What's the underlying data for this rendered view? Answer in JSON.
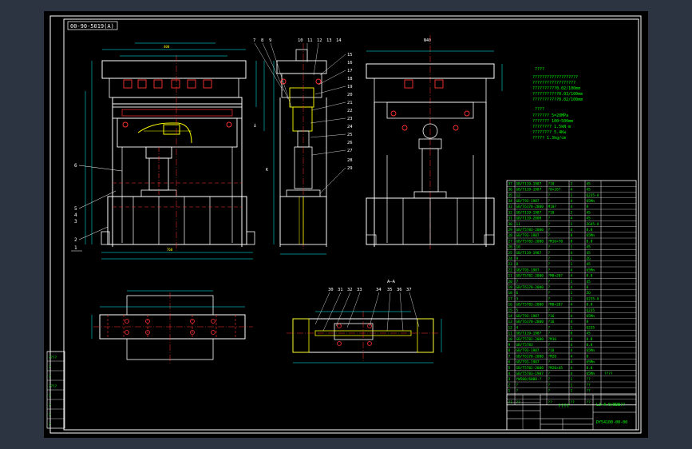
{
  "title_tag": "00-90-5019(A)",
  "section_label": "A—A",
  "section_arrow_label": "A",
  "view_label": "K",
  "top_dim_label": "N40",
  "notes_heading_1": "????",
  "notes_lines_1": [
    "???????????????????",
    "??????????????????",
    "??????????0.02/100mm",
    "???????????0.03/100mm",
    "???????????0.02/100mm"
  ],
  "notes_heading_2": "????",
  "notes_lines_2": [
    "??????? 5=20MPa",
    "??????? 100~500mm",
    "???????? 1.5kN·m",
    "???????? 5.4Kw",
    "????? 1.3kg/cm"
  ],
  "side_callouts": [
    "7",
    "8",
    "9",
    "10",
    "11",
    "12",
    "13",
    "14",
    "15",
    "16",
    "17",
    "18",
    "19",
    "20",
    "21",
    "22",
    "23",
    "24",
    "25",
    "26",
    "27",
    "28",
    "29"
  ],
  "left_callouts": [
    "6",
    "5",
    "4",
    "3",
    "2",
    "1"
  ],
  "section_callouts": [
    "30",
    "31",
    "32",
    "33",
    "34",
    "35",
    "36",
    "37"
  ],
  "bom_rows": [
    {
      "no": "37",
      "code": "GB/T119-1987",
      "name": "?10",
      "qty": "2",
      "mat": "45"
    },
    {
      "no": "36",
      "code": "GB/T119-1987",
      "name": "?8×26?",
      "qty": "4",
      "mat": "45"
    },
    {
      "no": "35",
      "code": "12",
      "name": "?",
      "qty": "1",
      "mat": "Q235-A"
    },
    {
      "no": "34",
      "code": "GB/T93-1987",
      "name": "?",
      "qty": "4",
      "mat": "65Mn"
    },
    {
      "no": "33",
      "code": "GB/T6170-2000",
      "name": "M10?",
      "qty": "4",
      "mat": "8"
    },
    {
      "no": "32",
      "code": "GB/T119-1987",
      "name": "?10",
      "qty": "2",
      "mat": "45"
    },
    {
      "no": "31",
      "code": "GB/T119-2000",
      "name": "?",
      "qty": "4",
      "mat": "45"
    },
    {
      "no": "30",
      "code": "11",
      "name": "?",
      "qty": "1",
      "mat": "ZG45-A"
    },
    {
      "no": "29",
      "code": "GB/T5783-2000",
      "name": "?",
      "qty": "4",
      "mat": "8.8"
    },
    {
      "no": "28",
      "code": "GB/T93-1987",
      "name": "?",
      "qty": "8",
      "mat": "65Mn"
    },
    {
      "no": "27",
      "code": "GB/T5783-2000",
      "name": "?M16×70",
      "qty": "8",
      "mat": "8.8"
    },
    {
      "no": "26",
      "code": "10",
      "name": "?",
      "qty": "1",
      "mat": "45"
    },
    {
      "no": "25",
      "code": "GB/T119-1987",
      "name": "?",
      "qty": "4",
      "mat": "45"
    },
    {
      "no": "24",
      "code": "9",
      "name": "?",
      "qty": "1",
      "mat": "ZG"
    },
    {
      "no": "23",
      "code": "8",
      "name": "?",
      "qty": "1",
      "mat": "45"
    },
    {
      "no": "22",
      "code": "GB/T93-1987",
      "name": "?",
      "qty": "4",
      "mat": "65Mn"
    },
    {
      "no": "21",
      "code": "GB/T5782-2000",
      "name": "?M8×20?",
      "qty": "4",
      "mat": "8.8"
    },
    {
      "no": "20",
      "code": "7",
      "name": "?",
      "qty": "1",
      "mat": "45"
    },
    {
      "no": "19",
      "code": "GB/T6170-2000",
      "name": "?",
      "qty": "4",
      "mat": "8"
    },
    {
      "no": "18",
      "code": "6",
      "name": "?",
      "qty": "1",
      "mat": "ZQ"
    },
    {
      "no": "17",
      "code": "3",
      "name": "?",
      "qty": "1",
      "mat": "Q235-A"
    },
    {
      "no": "16",
      "code": "GB/T5783-2000",
      "name": "?M8×20?",
      "qty": "4",
      "mat": "8.8"
    },
    {
      "no": "15",
      "code": "5",
      "name": "?",
      "qty": "1",
      "mat": "Q235"
    },
    {
      "no": "14",
      "code": "GB/T93-1987",
      "name": "?16",
      "qty": "4",
      "mat": "65Mn"
    },
    {
      "no": "13",
      "code": "GB/T6170-2000",
      "name": "?16",
      "qty": "4",
      "mat": "8"
    },
    {
      "no": "12",
      "code": "4",
      "name": "?",
      "qty": "1",
      "mat": "Q235"
    },
    {
      "no": "11",
      "code": "GB/T119-1987",
      "name": "?",
      "qty": "8",
      "mat": "45"
    },
    {
      "no": "10",
      "code": "GB/T5782-2000",
      "name": "?M16",
      "qty": "4",
      "mat": "8.8"
    },
    {
      "no": "9",
      "code": "GB/T5783",
      "name": "?",
      "qty": "4",
      "mat": "8.8"
    },
    {
      "no": "8",
      "code": "GB/T93-1987",
      "name": "?10",
      "qty": "4",
      "mat": "65Mn"
    },
    {
      "no": "7",
      "code": "GB/T6170-2000",
      "name": "?M20",
      "qty": "4",
      "mat": "8"
    },
    {
      "no": "6",
      "code": "GB/T93-1987",
      "name": "?",
      "qty": "4",
      "mat": "65Mn"
    },
    {
      "no": "5",
      "code": "GB/T5782-2000",
      "name": "?M20×45",
      "qty": "4",
      "mat": "8.8"
    },
    {
      "no": "4",
      "code": "GB/T5783-1987",
      "name": "?",
      "qty": "4",
      "mat": "65Mn"
    },
    {
      "no": "3",
      "code": "YW500/6000-?",
      "name": "?",
      "qty": "1",
      "mat": "??"
    },
    {
      "no": "2",
      "code": "?",
      "name": "?",
      "qty": "1",
      "mat": "??"
    },
    {
      "no": "1",
      "code": "?",
      "name": "?",
      "qty": "1",
      "mat": "??"
    }
  ],
  "bom_note": "????",
  "bom_header": {
    "no": "??",
    "code": "??",
    "name": "??",
    "qty": "??",
    "mat": "??"
  },
  "title_block": {
    "center": "????",
    "code1": "L3-4.0/BDB??",
    "code2": "DY54100-00-00"
  },
  "left_table": [
    "????",
    "?",
    "?",
    "????",
    "?",
    "?",
    "?",
    "?"
  ]
}
